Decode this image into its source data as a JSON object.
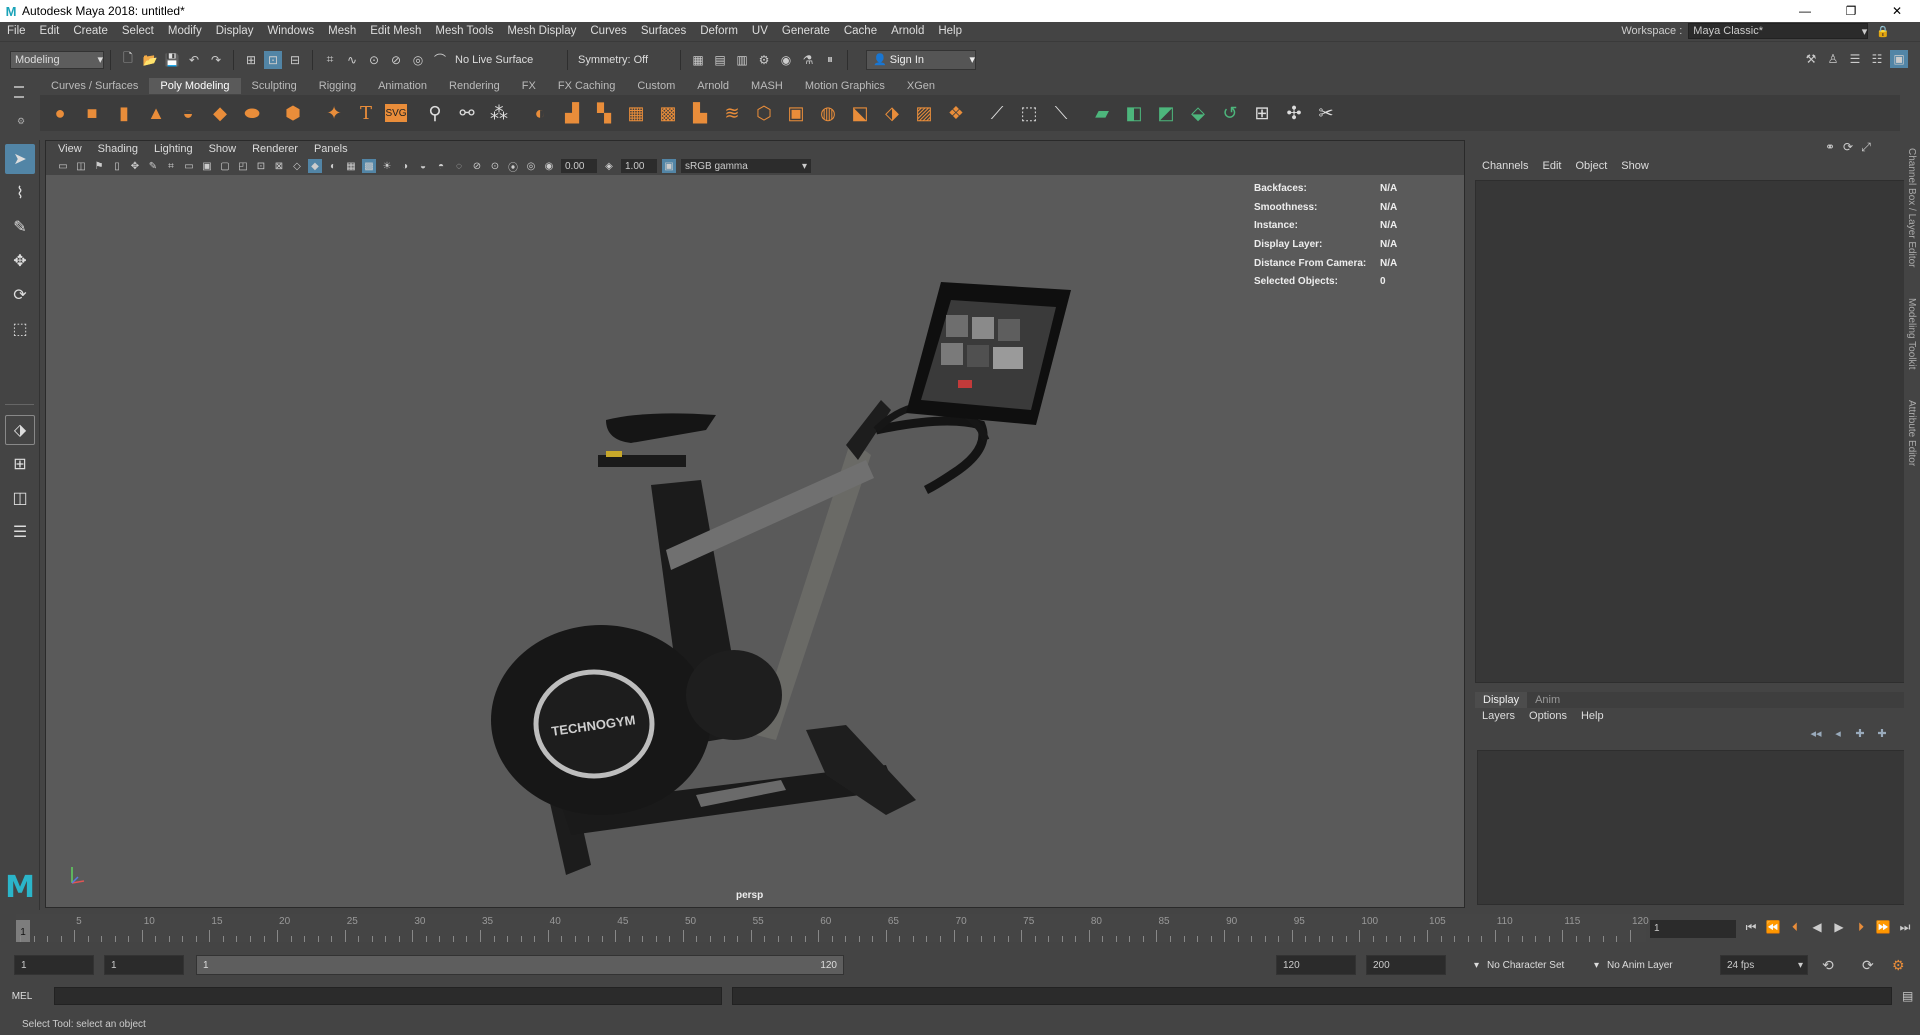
{
  "window": {
    "title": "Autodesk Maya 2018: untitled*",
    "minimize": "—",
    "maximize": "❐",
    "close": "✕"
  },
  "menubar": [
    "File",
    "Edit",
    "Create",
    "Select",
    "Modify",
    "Display",
    "Windows",
    "Mesh",
    "Edit Mesh",
    "Mesh Tools",
    "Mesh Display",
    "Curves",
    "Surfaces",
    "Deform",
    "UV",
    "Generate",
    "Cache",
    "Arnold",
    "Help"
  ],
  "workspace": {
    "label": "Workspace :",
    "value": "Maya Classic*"
  },
  "statusline": {
    "menuset": "Modeling",
    "live_surface": "No Live Surface",
    "symmetry": "Symmetry: Off",
    "sign_in": "Sign In"
  },
  "shelf": {
    "tabs": [
      "Curves / Surfaces",
      "Poly Modeling",
      "Sculpting",
      "Rigging",
      "Animation",
      "Rendering",
      "FX",
      "FX Caching",
      "Custom",
      "Arnold",
      "MASH",
      "Motion Graphics",
      "XGen"
    ],
    "active_tab": "Poly Modeling"
  },
  "viewport": {
    "menu": [
      "View",
      "Shading",
      "Lighting",
      "Show",
      "Renderer",
      "Panels"
    ],
    "exposure": "0.00",
    "gamma_value": "1.00",
    "color_space": "sRGB gamma",
    "camera": "persp",
    "hud": [
      {
        "key": "Backfaces:",
        "value": "N/A"
      },
      {
        "key": "Smoothness:",
        "value": "N/A"
      },
      {
        "key": "Instance:",
        "value": "N/A"
      },
      {
        "key": "Display Layer:",
        "value": "N/A"
      },
      {
        "key": "Distance From Camera:",
        "value": "N/A"
      },
      {
        "key": "Selected Objects:",
        "value": "0"
      }
    ],
    "model_logo_text": "TECHNOGYM"
  },
  "channel_box": {
    "menu": [
      "Channels",
      "Edit",
      "Object",
      "Show"
    ]
  },
  "layer_editor": {
    "tabs": [
      "Display",
      "Anim"
    ],
    "active_tab": "Display",
    "menu": [
      "Layers",
      "Options",
      "Help"
    ]
  },
  "side_tabs": [
    "Channel Box / Layer Editor",
    "Modeling Toolkit",
    "Attribute Editor"
  ],
  "timeline": {
    "labels": [
      "5",
      "10",
      "15",
      "20",
      "25",
      "30",
      "35",
      "40",
      "45",
      "50",
      "55",
      "60",
      "65",
      "70",
      "75",
      "80",
      "85",
      "90",
      "95",
      "100",
      "105",
      "110",
      "115",
      "120"
    ],
    "current_frame": "1",
    "frame_field": "1"
  },
  "range": {
    "start": "1",
    "anim_start": "1",
    "slider_start": "1",
    "slider_end": "120",
    "anim_end": "120",
    "end": "200",
    "character_set": "No Character Set",
    "anim_layer": "No Anim Layer",
    "fps": "24 fps"
  },
  "command_line": {
    "label": "MEL"
  },
  "help_line": "Select Tool: select an object"
}
